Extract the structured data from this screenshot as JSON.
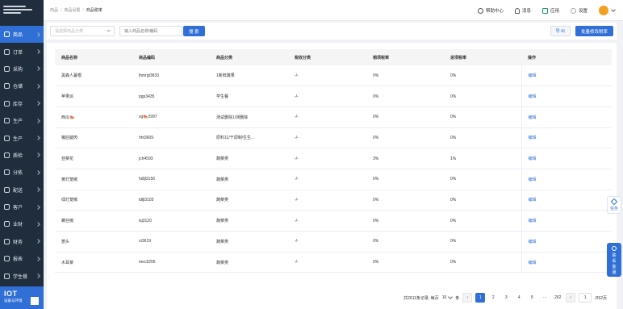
{
  "sidebar": {
    "items": [
      {
        "label": "商品",
        "active": true
      },
      {
        "label": "订单"
      },
      {
        "label": "采购"
      },
      {
        "label": "仓储"
      },
      {
        "label": "库存"
      },
      {
        "label": "生产"
      },
      {
        "label": "生产"
      },
      {
        "label": "质检"
      },
      {
        "label": "分拣"
      },
      {
        "label": "配送"
      },
      {
        "label": "客户"
      },
      {
        "label": "业财"
      },
      {
        "label": "财务"
      },
      {
        "label": "报表"
      },
      {
        "label": "学生餐"
      }
    ],
    "promo": {
      "title": "IOT",
      "subtitle": "设备与环境"
    }
  },
  "header": {
    "breadcrumb": [
      "商品",
      "商品设置",
      "商品税率"
    ],
    "help": "帮助中心",
    "message": "消息",
    "apps": "应用",
    "settings": "设置"
  },
  "toolbar": {
    "category_placeholder": "请选择商品分类",
    "search_placeholder": "输入商品名称/编码",
    "search_btn": "搜 索",
    "export_btn": "导 出",
    "batch_btn": "批量修改税率"
  },
  "table": {
    "columns": [
      "商品名称",
      "商品编码",
      "商品分类",
      "税收分类",
      "销项税率",
      "进项税率",
      "操作"
    ],
    "rows": [
      {
        "name": "黑森人蔓根",
        "code": "lhmrgt3833",
        "category": "1新鲜蔬果",
        "tax_class": "-/-",
        "sales_rate": "0%",
        "input_rate": "0%",
        "op": "编辑"
      },
      {
        "name": "苹果派",
        "code": "pgp3435",
        "category": "学生餐",
        "tax_class": "-/-",
        "sales_rate": "0%",
        "input_rate": "0%",
        "op": "编辑"
      },
      {
        "name": "西瓜🍉",
        "code": "xg🍉2997",
        "category": "测试删除1/测删除",
        "tax_class": "-/-",
        "sales_rate": "0%",
        "input_rate": "0%",
        "op": "编辑"
      },
      {
        "name": "猪后腿肉",
        "code": "hht3609",
        "category": "原料11/干调制/生生...",
        "tax_class": "-/-",
        "sales_rate": "0%",
        "input_rate": "0%",
        "op": "编辑"
      },
      {
        "name": "韭菜花",
        "code": "jch4593",
        "category": "蔬菜类",
        "tax_class": "-/-",
        "sales_rate": "3%",
        "input_rate": "1%",
        "op": "编辑"
      },
      {
        "name": "黄灯笼椒",
        "code": "hdljl3156",
        "category": "蔬菜类",
        "tax_class": "-/-",
        "sales_rate": "0%",
        "input_rate": "0%",
        "op": "编辑"
      },
      {
        "name": "绿灯笼椒",
        "code": "ldljl3105",
        "category": "蔬菜类",
        "tax_class": "-/-",
        "sales_rate": "0%",
        "input_rate": "0%",
        "op": "编辑"
      },
      {
        "name": "螺丝椒",
        "code": "lsj3120",
        "category": "蔬菜类",
        "tax_class": "-/-",
        "sales_rate": "0%",
        "input_rate": "0%",
        "op": "编辑"
      },
      {
        "name": "葱头",
        "code": "ct3619",
        "category": "蔬菜类",
        "tax_class": "-/-",
        "sales_rate": "0%",
        "input_rate": "0%",
        "op": "编辑"
      },
      {
        "name": "木耳菜",
        "code": "mec5206",
        "category": "蔬菜类",
        "tax_class": "-/-",
        "sales_rate": "0%",
        "input_rate": "0%",
        "op": "编辑"
      }
    ]
  },
  "pagination": {
    "total": "共2611条记录, 每页",
    "page_size": "10",
    "unit": "条",
    "pages": [
      "1",
      "2",
      "3",
      "4",
      "5"
    ],
    "ellipsis": "···",
    "last": "262",
    "prev": "‹",
    "next": "›",
    "goto_value": "1",
    "total_pages": "/262页"
  },
  "float": {
    "task": "任务",
    "contact": [
      "联",
      "系",
      "客",
      "服"
    ]
  },
  "colors": {
    "primary": "#2f6fd6",
    "sidebar": "#1f2d3d",
    "avatar": "#f0a020"
  }
}
